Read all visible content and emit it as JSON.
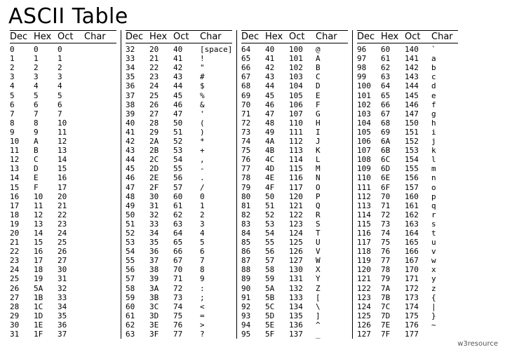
{
  "title": "ASCII Table",
  "footer": "w3resource",
  "headers": {
    "dec": "Dec",
    "hex": "Hex",
    "oct": "Oct",
    "char": "Char"
  },
  "blocks": [
    {
      "rows": [
        {
          "dec": "0",
          "hex": "0",
          "oct": "0",
          "char": ""
        },
        {
          "dec": "1",
          "hex": "1",
          "oct": "1",
          "char": ""
        },
        {
          "dec": "2",
          "hex": "2",
          "oct": "2",
          "char": ""
        },
        {
          "dec": "3",
          "hex": "3",
          "oct": "3",
          "char": ""
        },
        {
          "dec": "4",
          "hex": "4",
          "oct": "4",
          "char": ""
        },
        {
          "dec": "5",
          "hex": "5",
          "oct": "5",
          "char": ""
        },
        {
          "dec": "6",
          "hex": "6",
          "oct": "6",
          "char": ""
        },
        {
          "dec": "7",
          "hex": "7",
          "oct": "7",
          "char": ""
        },
        {
          "dec": "8",
          "hex": "8",
          "oct": "10",
          "char": ""
        },
        {
          "dec": "9",
          "hex": "9",
          "oct": "11",
          "char": ""
        },
        {
          "dec": "10",
          "hex": "A",
          "oct": "12",
          "char": ""
        },
        {
          "dec": "11",
          "hex": "B",
          "oct": "13",
          "char": ""
        },
        {
          "dec": "12",
          "hex": "C",
          "oct": "14",
          "char": ""
        },
        {
          "dec": "13",
          "hex": "D",
          "oct": "15",
          "char": ""
        },
        {
          "dec": "14",
          "hex": "E",
          "oct": "16",
          "char": ""
        },
        {
          "dec": "15",
          "hex": "F",
          "oct": "17",
          "char": ""
        },
        {
          "dec": "16",
          "hex": "10",
          "oct": "20",
          "char": ""
        },
        {
          "dec": "17",
          "hex": "11",
          "oct": "21",
          "char": ""
        },
        {
          "dec": "18",
          "hex": "12",
          "oct": "22",
          "char": ""
        },
        {
          "dec": "19",
          "hex": "13",
          "oct": "23",
          "char": ""
        },
        {
          "dec": "20",
          "hex": "14",
          "oct": "24",
          "char": ""
        },
        {
          "dec": "21",
          "hex": "15",
          "oct": "25",
          "char": ""
        },
        {
          "dec": "22",
          "hex": "16",
          "oct": "26",
          "char": ""
        },
        {
          "dec": "23",
          "hex": "17",
          "oct": "27",
          "char": ""
        },
        {
          "dec": "24",
          "hex": "18",
          "oct": "30",
          "char": ""
        },
        {
          "dec": "25",
          "hex": "19",
          "oct": "31",
          "char": ""
        },
        {
          "dec": "26",
          "hex": "5A",
          "oct": "32",
          "char": ""
        },
        {
          "dec": "27",
          "hex": "1B",
          "oct": "33",
          "char": ""
        },
        {
          "dec": "28",
          "hex": "1C",
          "oct": "34",
          "char": ""
        },
        {
          "dec": "29",
          "hex": "1D",
          "oct": "35",
          "char": ""
        },
        {
          "dec": "30",
          "hex": "1E",
          "oct": "36",
          "char": ""
        },
        {
          "dec": "31",
          "hex": "1F",
          "oct": "37",
          "char": ""
        }
      ]
    },
    {
      "rows": [
        {
          "dec": "32",
          "hex": "20",
          "oct": "40",
          "char": "[space]"
        },
        {
          "dec": "33",
          "hex": "21",
          "oct": "41",
          "char": "!"
        },
        {
          "dec": "34",
          "hex": "22",
          "oct": "42",
          "char": "\""
        },
        {
          "dec": "35",
          "hex": "23",
          "oct": "43",
          "char": "#"
        },
        {
          "dec": "36",
          "hex": "24",
          "oct": "44",
          "char": "$"
        },
        {
          "dec": "37",
          "hex": "25",
          "oct": "45",
          "char": "%"
        },
        {
          "dec": "38",
          "hex": "26",
          "oct": "46",
          "char": "&"
        },
        {
          "dec": "39",
          "hex": "27",
          "oct": "47",
          "char": "'"
        },
        {
          "dec": "40",
          "hex": "28",
          "oct": "50",
          "char": "("
        },
        {
          "dec": "41",
          "hex": "29",
          "oct": "51",
          "char": ")"
        },
        {
          "dec": "42",
          "hex": "2A",
          "oct": "52",
          "char": "*"
        },
        {
          "dec": "43",
          "hex": "2B",
          "oct": "53",
          "char": "+"
        },
        {
          "dec": "44",
          "hex": "2C",
          "oct": "54",
          "char": ","
        },
        {
          "dec": "45",
          "hex": "2D",
          "oct": "55",
          "char": "-"
        },
        {
          "dec": "46",
          "hex": "2E",
          "oct": "56",
          "char": "."
        },
        {
          "dec": "47",
          "hex": "2F",
          "oct": "57",
          "char": "/"
        },
        {
          "dec": "48",
          "hex": "30",
          "oct": "60",
          "char": "0"
        },
        {
          "dec": "49",
          "hex": "31",
          "oct": "61",
          "char": "1"
        },
        {
          "dec": "50",
          "hex": "32",
          "oct": "62",
          "char": "2"
        },
        {
          "dec": "51",
          "hex": "33",
          "oct": "63",
          "char": "3"
        },
        {
          "dec": "52",
          "hex": "34",
          "oct": "64",
          "char": "4"
        },
        {
          "dec": "53",
          "hex": "35",
          "oct": "65",
          "char": "5"
        },
        {
          "dec": "54",
          "hex": "36",
          "oct": "66",
          "char": "6"
        },
        {
          "dec": "55",
          "hex": "37",
          "oct": "67",
          "char": "7"
        },
        {
          "dec": "56",
          "hex": "38",
          "oct": "70",
          "char": "8"
        },
        {
          "dec": "57",
          "hex": "39",
          "oct": "71",
          "char": "9"
        },
        {
          "dec": "58",
          "hex": "3A",
          "oct": "72",
          "char": ":"
        },
        {
          "dec": "59",
          "hex": "3B",
          "oct": "73",
          "char": ";"
        },
        {
          "dec": "60",
          "hex": "3C",
          "oct": "74",
          "char": "<"
        },
        {
          "dec": "61",
          "hex": "3D",
          "oct": "75",
          "char": "="
        },
        {
          "dec": "62",
          "hex": "3E",
          "oct": "76",
          "char": ">"
        },
        {
          "dec": "63",
          "hex": "3F",
          "oct": "77",
          "char": "?"
        }
      ]
    },
    {
      "rows": [
        {
          "dec": "64",
          "hex": "40",
          "oct": "100",
          "char": "@"
        },
        {
          "dec": "65",
          "hex": "41",
          "oct": "101",
          "char": "A"
        },
        {
          "dec": "66",
          "hex": "42",
          "oct": "102",
          "char": "B"
        },
        {
          "dec": "67",
          "hex": "43",
          "oct": "103",
          "char": "C"
        },
        {
          "dec": "68",
          "hex": "44",
          "oct": "104",
          "char": "D"
        },
        {
          "dec": "69",
          "hex": "45",
          "oct": "105",
          "char": "E"
        },
        {
          "dec": "70",
          "hex": "46",
          "oct": "106",
          "char": "F"
        },
        {
          "dec": "71",
          "hex": "47",
          "oct": "107",
          "char": "G"
        },
        {
          "dec": "72",
          "hex": "48",
          "oct": "110",
          "char": "H"
        },
        {
          "dec": "73",
          "hex": "49",
          "oct": "111",
          "char": "I"
        },
        {
          "dec": "74",
          "hex": "4A",
          "oct": "112",
          "char": "J"
        },
        {
          "dec": "75",
          "hex": "4B",
          "oct": "113",
          "char": "K"
        },
        {
          "dec": "76",
          "hex": "4C",
          "oct": "114",
          "char": "L"
        },
        {
          "dec": "77",
          "hex": "4D",
          "oct": "115",
          "char": "M"
        },
        {
          "dec": "78",
          "hex": "4E",
          "oct": "116",
          "char": "N"
        },
        {
          "dec": "79",
          "hex": "4F",
          "oct": "117",
          "char": "O"
        },
        {
          "dec": "80",
          "hex": "50",
          "oct": "120",
          "char": "P"
        },
        {
          "dec": "81",
          "hex": "51",
          "oct": "121",
          "char": "Q"
        },
        {
          "dec": "82",
          "hex": "52",
          "oct": "122",
          "char": "R"
        },
        {
          "dec": "83",
          "hex": "53",
          "oct": "123",
          "char": "S"
        },
        {
          "dec": "84",
          "hex": "54",
          "oct": "124",
          "char": "T"
        },
        {
          "dec": "85",
          "hex": "55",
          "oct": "125",
          "char": "U"
        },
        {
          "dec": "86",
          "hex": "56",
          "oct": "126",
          "char": "V"
        },
        {
          "dec": "87",
          "hex": "57",
          "oct": "127",
          "char": "W"
        },
        {
          "dec": "88",
          "hex": "58",
          "oct": "130",
          "char": "X"
        },
        {
          "dec": "89",
          "hex": "59",
          "oct": "131",
          "char": "Y"
        },
        {
          "dec": "90",
          "hex": "5A",
          "oct": "132",
          "char": "Z"
        },
        {
          "dec": "91",
          "hex": "5B",
          "oct": "133",
          "char": "["
        },
        {
          "dec": "92",
          "hex": "5C",
          "oct": "134",
          "char": "\\"
        },
        {
          "dec": "93",
          "hex": "5D",
          "oct": "135",
          "char": "]"
        },
        {
          "dec": "94",
          "hex": "5E",
          "oct": "136",
          "char": "^"
        },
        {
          "dec": "95",
          "hex": "5F",
          "oct": "137",
          "char": "_"
        }
      ]
    },
    {
      "rows": [
        {
          "dec": "96",
          "hex": "60",
          "oct": "140",
          "char": "`"
        },
        {
          "dec": "97",
          "hex": "61",
          "oct": "141",
          "char": "a"
        },
        {
          "dec": "98",
          "hex": "62",
          "oct": "142",
          "char": "b"
        },
        {
          "dec": "99",
          "hex": "63",
          "oct": "143",
          "char": "c"
        },
        {
          "dec": "100",
          "hex": "64",
          "oct": "144",
          "char": "d"
        },
        {
          "dec": "101",
          "hex": "65",
          "oct": "145",
          "char": "e"
        },
        {
          "dec": "102",
          "hex": "66",
          "oct": "146",
          "char": "f"
        },
        {
          "dec": "103",
          "hex": "67",
          "oct": "147",
          "char": "g"
        },
        {
          "dec": "104",
          "hex": "68",
          "oct": "150",
          "char": "h"
        },
        {
          "dec": "105",
          "hex": "69",
          "oct": "151",
          "char": "i"
        },
        {
          "dec": "106",
          "hex": "6A",
          "oct": "152",
          "char": "j"
        },
        {
          "dec": "107",
          "hex": "6B",
          "oct": "153",
          "char": "k"
        },
        {
          "dec": "108",
          "hex": "6C",
          "oct": "154",
          "char": "l"
        },
        {
          "dec": "109",
          "hex": "6D",
          "oct": "155",
          "char": "m"
        },
        {
          "dec": "110",
          "hex": "6E",
          "oct": "156",
          "char": "n"
        },
        {
          "dec": "111",
          "hex": "6F",
          "oct": "157",
          "char": "o"
        },
        {
          "dec": "112",
          "hex": "70",
          "oct": "160",
          "char": "p"
        },
        {
          "dec": "113",
          "hex": "71",
          "oct": "161",
          "char": "q"
        },
        {
          "dec": "114",
          "hex": "72",
          "oct": "162",
          "char": "r"
        },
        {
          "dec": "115",
          "hex": "73",
          "oct": "163",
          "char": "s"
        },
        {
          "dec": "116",
          "hex": "74",
          "oct": "164",
          "char": "t"
        },
        {
          "dec": "117",
          "hex": "75",
          "oct": "165",
          "char": "u"
        },
        {
          "dec": "118",
          "hex": "76",
          "oct": "166",
          "char": "v"
        },
        {
          "dec": "119",
          "hex": "77",
          "oct": "167",
          "char": "w"
        },
        {
          "dec": "120",
          "hex": "78",
          "oct": "170",
          "char": "x"
        },
        {
          "dec": "121",
          "hex": "79",
          "oct": "171",
          "char": "y"
        },
        {
          "dec": "122",
          "hex": "7A",
          "oct": "172",
          "char": "z"
        },
        {
          "dec": "123",
          "hex": "7B",
          "oct": "173",
          "char": "{"
        },
        {
          "dec": "124",
          "hex": "7C",
          "oct": "174",
          "char": "|"
        },
        {
          "dec": "125",
          "hex": "7D",
          "oct": "175",
          "char": "}"
        },
        {
          "dec": "126",
          "hex": "7E",
          "oct": "176",
          "char": "~"
        },
        {
          "dec": "127",
          "hex": "7F",
          "oct": "177",
          "char": ""
        }
      ]
    }
  ]
}
